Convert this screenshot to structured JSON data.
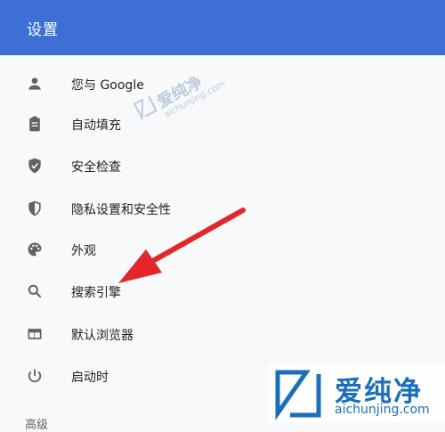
{
  "header": {
    "title": "设置"
  },
  "menu": {
    "items": [
      {
        "label": "您与 Google",
        "icon": "person-icon"
      },
      {
        "label": "自动填充",
        "icon": "clipboard-icon"
      },
      {
        "label": "安全检查",
        "icon": "shield-check-icon"
      },
      {
        "label": "隐私设置和安全性",
        "icon": "shield-half-icon"
      },
      {
        "label": "外观",
        "icon": "palette-icon"
      },
      {
        "label": "搜索引擎",
        "icon": "search-icon"
      },
      {
        "label": "默认浏览器",
        "icon": "browser-window-icon"
      },
      {
        "label": "启动时",
        "icon": "power-icon"
      }
    ],
    "partial_next": "高级"
  },
  "watermark": {
    "cn": "爱纯净",
    "en": "aichunjing.com"
  },
  "colors": {
    "header": "#3d6fd5",
    "icon": "#5f6368",
    "arrow": "#e3262b"
  }
}
